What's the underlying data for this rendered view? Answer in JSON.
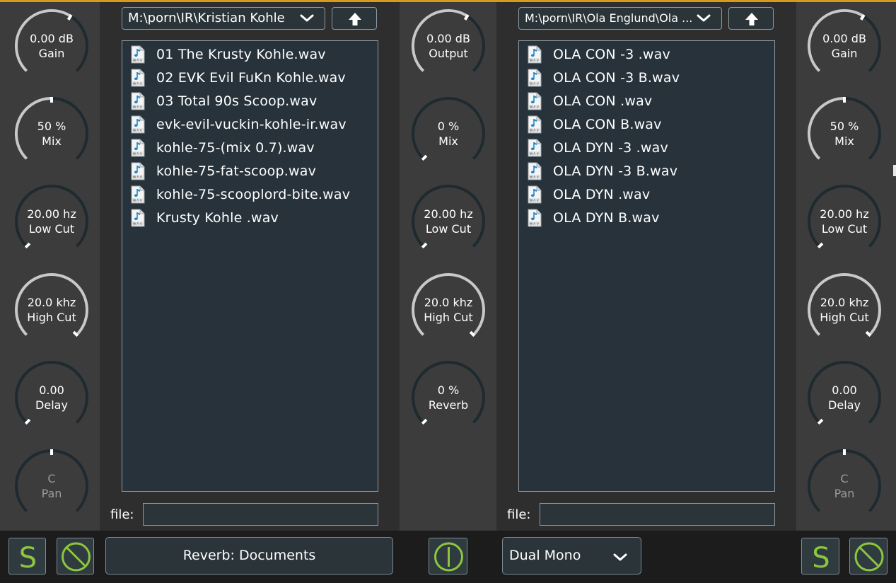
{
  "left_strip": {
    "knobs": [
      {
        "value": "0.00 dB",
        "label": "Gain",
        "level": 0.62
      },
      {
        "value": "50 %",
        "label": "Mix",
        "level": 0.5
      },
      {
        "value": "20.00 hz",
        "label": "Low Cut",
        "level": 0.0
      },
      {
        "value": "20.0 khz",
        "label": "High Cut",
        "level": 1.0
      },
      {
        "value": "0.00",
        "label": "Delay",
        "level": 0.0
      },
      {
        "value": "C",
        "label": "Pan",
        "level": 0.5
      }
    ],
    "solo_label": "S",
    "mute_icon": "prohibited-icon"
  },
  "left_browser": {
    "path": "M:\\porn\\IR\\Kristian Kohle",
    "up_icon": "arrow-up-icon",
    "files": [
      "01 The Krusty Kohle.wav",
      "02 EVK Evil FuKn Kohle.wav",
      "03 Total 90s Scoop.wav",
      "evk-evil-vuckin-kohle-ir.wav",
      "kohle-75-(mix 0.7).wav",
      "kohle-75-fat-scoop.wav",
      "kohle-75-scooplord-bite.wav",
      "Krusty Kohle .wav"
    ],
    "file_label": "file:",
    "file_value": ""
  },
  "center_strip": {
    "knobs": [
      {
        "value": "0.00 dB",
        "label": "Output",
        "level": 0.62
      },
      {
        "value": "0 %",
        "label": "Mix",
        "level": 0.0
      },
      {
        "value": "20.00 hz",
        "label": "Low Cut",
        "level": 0.0
      },
      {
        "value": "20.0 khz",
        "label": "High Cut",
        "level": 1.0
      },
      {
        "value": "0 %",
        "label": "Reverb",
        "level": 0.0
      }
    ],
    "power_icon": "power-icon"
  },
  "right_browser": {
    "path": "M:\\porn\\IR\\Ola Englund\\Ola ...",
    "up_icon": "arrow-up-icon",
    "files": [
      "OLA CON -3 .wav",
      "OLA CON -3 B.wav",
      "OLA CON .wav",
      "OLA CON B.wav",
      "OLA DYN -3 .wav",
      "OLA DYN -3 B.wav",
      "OLA DYN .wav",
      "OLA DYN B.wav"
    ],
    "file_label": "file:",
    "file_value": ""
  },
  "right_strip": {
    "knobs": [
      {
        "value": "0.00 dB",
        "label": "Gain",
        "level": 0.62
      },
      {
        "value": "50 %",
        "label": "Mix",
        "level": 0.5
      },
      {
        "value": "20.00 hz",
        "label": "Low Cut",
        "level": 0.0
      },
      {
        "value": "20.0 khz",
        "label": "High Cut",
        "level": 1.0
      },
      {
        "value": "0.00",
        "label": "Delay",
        "level": 0.0
      },
      {
        "value": "C",
        "label": "Pan",
        "level": 0.5
      }
    ],
    "solo_label": "S",
    "mute_icon": "prohibited-icon"
  },
  "bottom_bar": {
    "reverb_button": "Reverb: Documents",
    "mode_select": "Dual Mono"
  },
  "colors": {
    "accent_green": "#8cc63f",
    "knob_arc": "#c8c8c8",
    "knob_track": "#1e2a30",
    "top_line": "#d79a1c"
  }
}
